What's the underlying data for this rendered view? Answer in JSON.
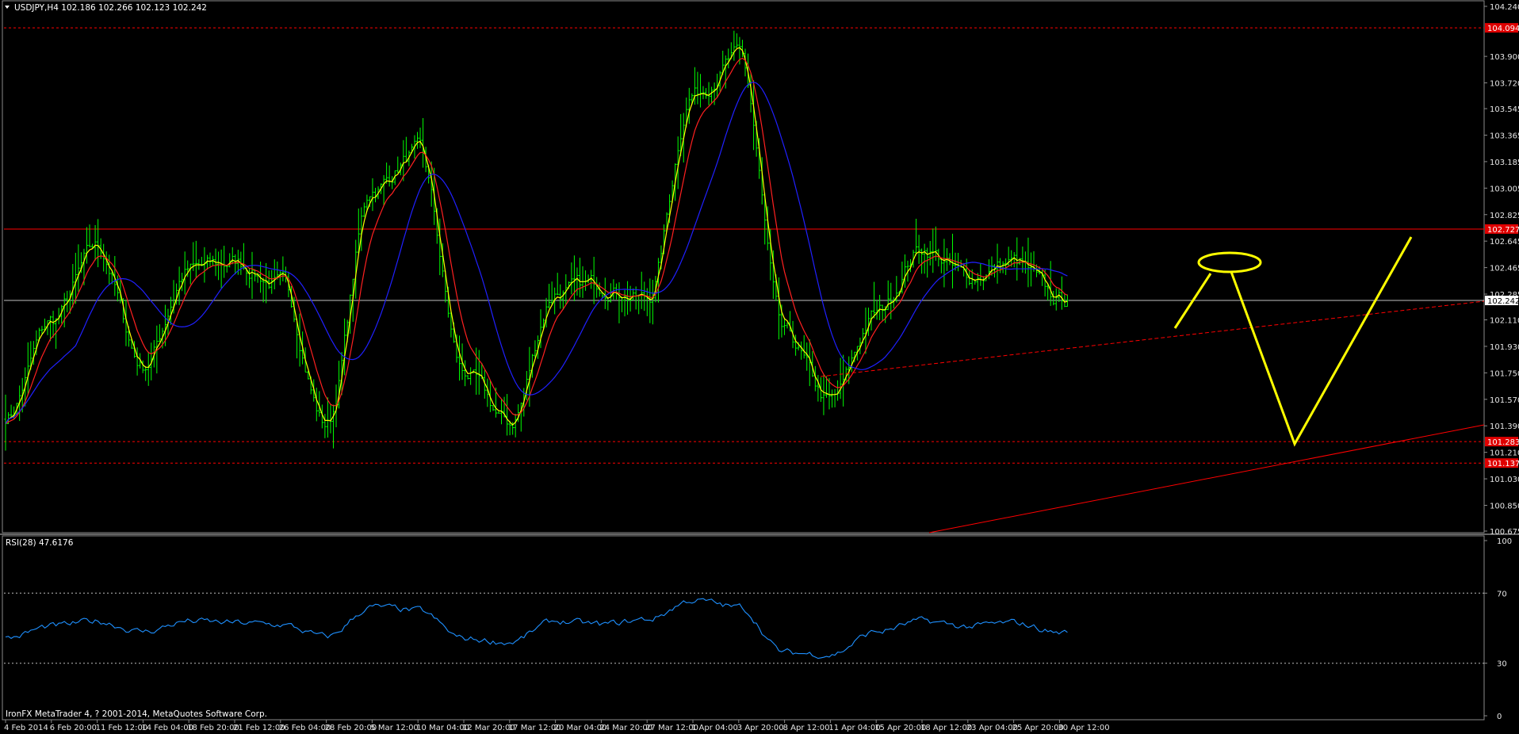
{
  "window": {
    "symbol_header": "USDJPY,H4  102.186 102.266 102.123 102.242",
    "rsi_header": "RSI(28) 47.6176",
    "footer": "IronFX MetaTrader 4, ? 2001-2014, MetaQuotes Software Corp."
  },
  "colors": {
    "background": "#000000",
    "candles": "#00ff00",
    "fast_ma": "#ffff00",
    "mid_ma": "#ff2020",
    "slow_ma": "#2020ff",
    "levels": "#ff0000",
    "drawing": "#ffff00",
    "rsi": "#1e90ff",
    "axis_text": "#e6e6e6"
  },
  "chart_data": [
    {
      "type": "candlestick",
      "title": "USDJPY,H4",
      "ohlc_last": {
        "open": 102.186,
        "high": 102.266,
        "low": 102.123,
        "close": 102.242
      },
      "y_ticks": [
        "104.240",
        "103.900",
        "103.720",
        "103.545",
        "103.365",
        "103.185",
        "103.005",
        "102.825",
        "102.645",
        "102.465",
        "102.285",
        "102.110",
        "101.930",
        "101.750",
        "101.570",
        "101.390",
        "101.210",
        "101.030",
        "100.850",
        "100.675"
      ],
      "ylim": [
        100.675,
        104.24
      ],
      "x_labels": [
        "4 Feb 2014",
        "6 Feb 20:00",
        "11 Feb 12:00",
        "14 Feb 04:00",
        "18 Feb 20:00",
        "21 Feb 12:00",
        "26 Feb 04:00",
        "28 Feb 20:00",
        "5 Mar 12:00",
        "10 Mar 04:00",
        "12 Mar 20:00",
        "17 Mar 12:00",
        "20 Mar 04:00",
        "24 Mar 20:00",
        "27 Mar 12:00",
        "1 Apr 04:00",
        "3 Apr 20:00",
        "8 Apr 12:00",
        "11 Apr 04:00",
        "15 Apr 20:00",
        "18 Apr 12:00",
        "23 Apr 04:00",
        "25 Apr 20:00",
        "30 Apr 12:00"
      ],
      "price_path": [
        {
          "x": "4 Feb 2014",
          "y": 101.45
        },
        {
          "x": "6 Feb 20:00",
          "y": 102.1
        },
        {
          "x": "11 Feb 12:00",
          "y": 102.6
        },
        {
          "x": "14 Feb 04:00",
          "y": 101.8
        },
        {
          "x": "18 Feb 20:00",
          "y": 102.45
        },
        {
          "x": "21 Feb 12:00",
          "y": 102.5
        },
        {
          "x": "26 Feb 04:00",
          "y": 102.35
        },
        {
          "x": "28 Feb 20:00",
          "y": 101.4
        },
        {
          "x": "5 Mar 12:00",
          "y": 103.0
        },
        {
          "x": "10 Mar 04:00",
          "y": 103.25
        },
        {
          "x": "12 Mar 20:00",
          "y": 101.75
        },
        {
          "x": "17 Mar 12:00",
          "y": 101.4
        },
        {
          "x": "20 Mar 04:00",
          "y": 102.3
        },
        {
          "x": "24 Mar 20:00",
          "y": 102.35
        },
        {
          "x": "27 Mar 12:00",
          "y": 102.25
        },
        {
          "x": "1 Apr 04:00",
          "y": 103.65
        },
        {
          "x": "3 Apr 20:00",
          "y": 103.9
        },
        {
          "x": "8 Apr 12:00",
          "y": 102.0
        },
        {
          "x": "11 Apr 04:00",
          "y": 101.55
        },
        {
          "x": "15 Apr 20:00",
          "y": 102.15
        },
        {
          "x": "18 Apr 12:00",
          "y": 102.6
        },
        {
          "x": "23 Apr 04:00",
          "y": 102.4
        },
        {
          "x": "25 Apr 20:00",
          "y": 102.5
        },
        {
          "x": "30 Apr 12:00",
          "y": 102.242
        }
      ],
      "horizontal_levels": [
        {
          "price": 104.094,
          "label": "104.094",
          "style": "dashed"
        },
        {
          "price": 102.727,
          "label": "102.727",
          "style": "solid"
        },
        {
          "price": 102.242,
          "label": "102.242",
          "style": "current"
        },
        {
          "price": 101.283,
          "label": "101.283",
          "style": "dashed"
        },
        {
          "price": 101.137,
          "label": "101.137",
          "style": "dashed"
        }
      ],
      "moving_averages": [
        "fast (yellow)",
        "medium (red)",
        "slow (blue)"
      ]
    },
    {
      "type": "line",
      "title": "RSI(28)",
      "value": 47.6176,
      "y_ticks": [
        "100",
        "70",
        "30",
        "0"
      ],
      "ylim": [
        0,
        100
      ],
      "levels": [
        70,
        30
      ],
      "values": [
        {
          "x": "4 Feb 2014",
          "y": 44
        },
        {
          "x": "6 Feb 20:00",
          "y": 51
        },
        {
          "x": "11 Feb 12:00",
          "y": 54
        },
        {
          "x": "14 Feb 04:00",
          "y": 48
        },
        {
          "x": "18 Feb 20:00",
          "y": 54
        },
        {
          "x": "21 Feb 12:00",
          "y": 53
        },
        {
          "x": "26 Feb 04:00",
          "y": 52
        },
        {
          "x": "28 Feb 20:00",
          "y": 45
        },
        {
          "x": "5 Mar 12:00",
          "y": 62
        },
        {
          "x": "10 Mar 04:00",
          "y": 60
        },
        {
          "x": "12 Mar 20:00",
          "y": 44
        },
        {
          "x": "17 Mar 12:00",
          "y": 42
        },
        {
          "x": "20 Mar 04:00",
          "y": 54
        },
        {
          "x": "24 Mar 20:00",
          "y": 52
        },
        {
          "x": "27 Mar 12:00",
          "y": 55
        },
        {
          "x": "1 Apr 04:00",
          "y": 66
        },
        {
          "x": "3 Apr 20:00",
          "y": 62
        },
        {
          "x": "8 Apr 12:00",
          "y": 36
        },
        {
          "x": "11 Apr 04:00",
          "y": 35
        },
        {
          "x": "15 Apr 20:00",
          "y": 48
        },
        {
          "x": "18 Apr 12:00",
          "y": 54
        },
        {
          "x": "23 Apr 04:00",
          "y": 51
        },
        {
          "x": "25 Apr 20:00",
          "y": 53
        },
        {
          "x": "30 Apr 12:00",
          "y": 47.6
        }
      ]
    }
  ]
}
